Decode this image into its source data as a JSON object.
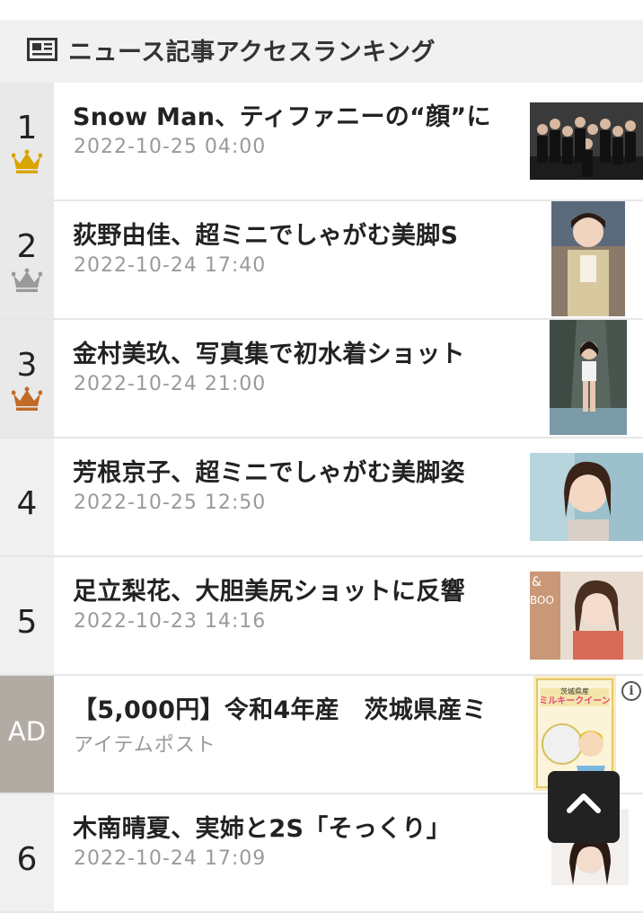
{
  "header": {
    "title": "ニュース記事アクセスランキング",
    "icon": "newspaper-icon"
  },
  "items": [
    {
      "rank": "1",
      "title": "Snow Man、ティファニーの“顔”に",
      "date": "2022-10-25 04:00",
      "crown": "gold",
      "crown_color": "#d9a400"
    },
    {
      "rank": "2",
      "title": "荻野由佳、超ミニでしゃがむ美脚S",
      "date": "2022-10-24 17:40",
      "crown": "silver",
      "crown_color": "#9a9a9a"
    },
    {
      "rank": "3",
      "title": "金村美玖、写真集で初水着ショット",
      "date": "2022-10-24 21:00",
      "crown": "bronze",
      "crown_color": "#c26a28"
    },
    {
      "rank": "4",
      "title": "芳根京子、超ミニでしゃがむ美脚姿",
      "date": "2022-10-25 12:50"
    },
    {
      "rank": "5",
      "title": "足立梨花、大胆美尻ショットに反響",
      "date": "2022-10-23 14:16"
    },
    {
      "rank": "AD",
      "title": "【5,000円】令和4年産　茨城県産ミ",
      "date": "アイテムポスト",
      "ad": true
    },
    {
      "rank": "6",
      "title": "木南晴夏、実姉と2S「そっくり」",
      "date": "2022-10-24 17:09"
    }
  ],
  "ad_info_icon": "i",
  "scroll_top_icon": "chevron-up-icon"
}
